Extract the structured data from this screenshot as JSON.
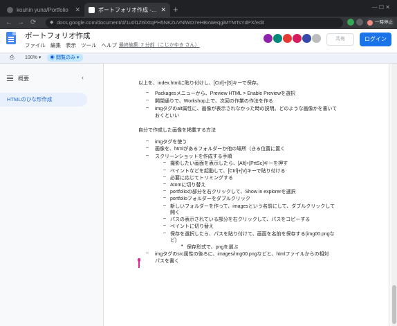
{
  "browser": {
    "tabs": [
      {
        "title": "kouhin yuna/Portfolio",
        "active": false
      },
      {
        "title": "ポートフォリオ作成 - Google ドキュメント",
        "active": true
      }
    ],
    "new_tab": "+",
    "url": "docs.google.com/document/d/1u0l1Z6lXtqPH5NKZuVNlWD7eHBxWeqgiMTMTsYdPX/edit",
    "pause_label": "一時停止"
  },
  "docs": {
    "title": "ポートフォリオ作成",
    "menu": [
      "ファイル",
      "編集",
      "表示",
      "ツール",
      "ヘルプ"
    ],
    "last_edit": "最終編集: 2 分前（こじかゆき さん）",
    "share_label": "共有",
    "login_label": "ログイン",
    "zoom": "100%",
    "mode_label": "閲覧のみ"
  },
  "outline": {
    "title": "概要",
    "collapse_icon": "‹",
    "items": [
      "HTMLのひな形作成"
    ]
  },
  "content": {
    "lines": [
      {
        "type": "p",
        "text": "以上を、index.htmlに貼り付けし、[Ctrl]+[S]キーで保存。"
      },
      {
        "type": "b1",
        "text": "Packagesメニューから、Preview HTML > Enable Previewを選択"
      },
      {
        "type": "b1",
        "text": "開閉通りで、Workshop上で、次回の作業の作法を作る"
      },
      {
        "type": "b1",
        "text": "imgタグのalt属性に、画像が表示されなかった時の説明。どのような画像かを書いて"
      },
      {
        "type": "cont",
        "text": "おくといい"
      },
      {
        "type": "p",
        "text": "自分で作成した画像を掲載する方法"
      },
      {
        "type": "b1",
        "text": "imgタグを使う"
      },
      {
        "type": "b1",
        "text": "画像を、htmlがあるフォルダーか他の場所（きる位置に置く"
      },
      {
        "type": "b1",
        "text": "スクリーンショットを作成する手順"
      },
      {
        "type": "b2",
        "text": "撮影したい画面を表示したら、[Alt]+[PrtSc]キーを押す"
      },
      {
        "type": "b2",
        "text": "ペイントなどを起動して、[Ctrl]+[V]キーで貼り付ける"
      },
      {
        "type": "b2",
        "text": "必要に応じてトリミングする"
      },
      {
        "type": "b2",
        "text": "Atomに切り替え"
      },
      {
        "type": "b2",
        "text": "portfolioの部分を右クリックして、Show in explorerを選択"
      },
      {
        "type": "b2",
        "text": "portfolioフォルダーをダブルクリック"
      },
      {
        "type": "b2",
        "text": "新しいフォルダーを作って、imagesという名前にして、ダブルクリックして"
      },
      {
        "type": "cont2",
        "text": "開く"
      },
      {
        "type": "b2",
        "text": "パスの表示されている部分を右クリックして、パスをコピーする"
      },
      {
        "type": "b2",
        "text": "ペイントに切り替え"
      },
      {
        "type": "b2",
        "text": "保存を選択したら、パスを貼り付けて、画面を名前を保存する(img00.pngな"
      },
      {
        "type": "cont2",
        "text": "ど)"
      },
      {
        "type": "b3",
        "text": "保存形式で、pngを選ぶ"
      },
      {
        "type": "b1",
        "text": "imgタグのsrc属性の後ろに、images/img00.pngなどと、htmlファイルからの相対"
      },
      {
        "type": "cont",
        "text": "パスを書く"
      }
    ]
  },
  "icons": {
    "back": "←",
    "forward": "→",
    "reload": "⟳",
    "lock": "🔒",
    "star": "☆",
    "print": "⎙",
    "eye": "👁",
    "dropdown": "▾"
  },
  "colors": {
    "accent": "#1a73e8",
    "outline_selected_bg": "#e8f0fe",
    "outline_selected_text": "#1967d2",
    "cursor": "#e52592"
  }
}
